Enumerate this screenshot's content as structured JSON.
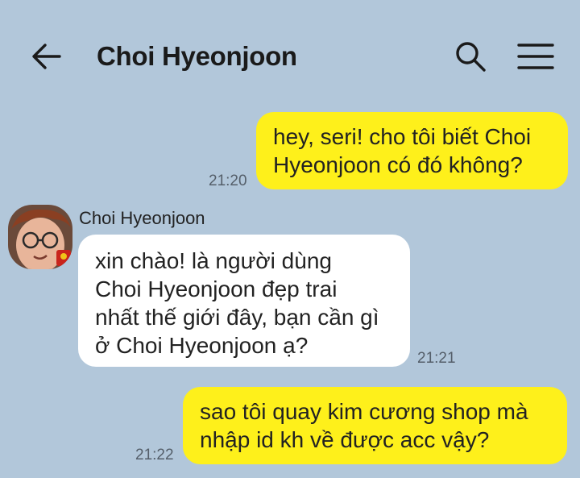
{
  "header": {
    "title": "Choi Hyeonjoon",
    "back_icon": "arrow-left-icon",
    "search_icon": "search-icon",
    "menu_icon": "hamburger-menu-icon"
  },
  "messages": [
    {
      "from": "me",
      "lines": [
        "hey, seri! cho tôi biết Choi",
        "Hyeonjoon có đó không?"
      ],
      "time": "21:20"
    },
    {
      "from": "them",
      "sender": "Choi Hyeonjoon",
      "lines": [
        "xin chào! là người dùng",
        "Choi Hyeonjoon đẹp trai",
        "nhất thế giới đây, bạn cần gì",
        "ở Choi Hyeonjoon ạ?"
      ],
      "time": "21:21"
    },
    {
      "from": "me",
      "lines": [
        "sao tôi quay kim cương shop mà",
        "nhập id kh về được acc vậy?"
      ],
      "time": "21:22"
    }
  ],
  "colors": {
    "background": "#b2c7da",
    "my_bubble": "#fef01b",
    "their_bubble": "#ffffff"
  }
}
